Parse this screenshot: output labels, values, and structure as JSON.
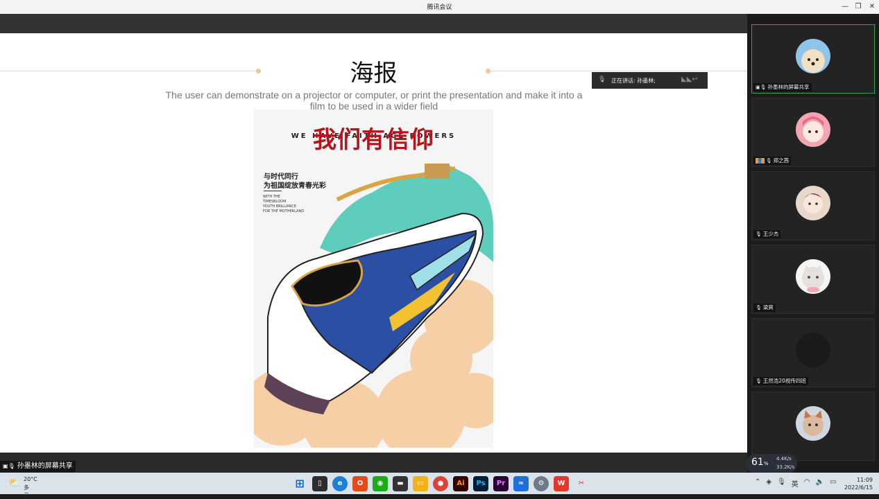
{
  "window": {
    "title": "腾讯会议",
    "minimize": "—",
    "restore": "❐",
    "close": "✕"
  },
  "slide": {
    "title": "海报",
    "subtitle": "The user can demonstrate on a projector or computer, or print the presentation and make it into a film to be used in a wider field",
    "poster": {
      "title_cn": "我们有信仰",
      "title_en": "WE HAVE FAITH AGE POWERS",
      "slogan_line1": "与时代同行",
      "slogan_line2": "为祖国绽放青春光彩",
      "small_en_lines": [
        "WITH THE",
        "TIMESBLOOM",
        "YOUTH BRILLIANCE",
        "FOR THE MOTHERLAND"
      ]
    }
  },
  "speaking": {
    "label": "正在讲话: 孙墨林;"
  },
  "share_label": "孙墨林的屏幕共享",
  "participants": [
    {
      "name": "孙墨林的屏幕共享",
      "avatar": "dog-avatar",
      "color": "#f2e0c4"
    },
    {
      "name": "郑之茜",
      "avatar": "anime-girl-avatar",
      "color": "#f7c6cc"
    },
    {
      "name": "王少杰",
      "avatar": "anime-avatar",
      "color": "#e8d8cc"
    },
    {
      "name": "梁爽",
      "avatar": "cat-avatar",
      "color": "#eeeeee"
    },
    {
      "name": "王然浩20视传四班",
      "avatar": "blank-avatar",
      "color": "#1a1a1a"
    },
    {
      "name": "",
      "avatar": "fox-avatar",
      "color": "#d9b9a0"
    }
  ],
  "perf": {
    "cpu": "61",
    "unit": "%",
    "up": "4.4K/s",
    "down": "33.2K/s"
  },
  "taskbar": {
    "weather_temp": "20°C",
    "weather_desc": "多云",
    "ime": "英",
    "time": "11:09",
    "date": "2022/6/15"
  },
  "colors": {
    "active_border": "#2fa44f",
    "poster_red": "#b4151e",
    "train_blue": "#2a4fa3",
    "mountain_teal": "#5fcdbb",
    "cloud_peach": "#f6cfa6"
  }
}
